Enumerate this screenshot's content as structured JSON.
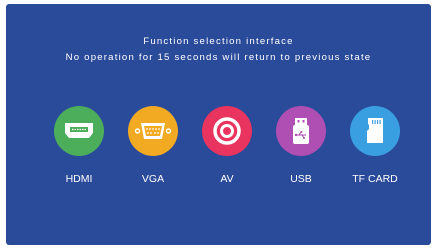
{
  "header": {
    "title": "Function selection interface",
    "subtitle": "No operation for 15 seconds will return to previous state"
  },
  "sources": [
    {
      "label": "HDMI",
      "icon": "hdmi-port-icon",
      "color": "#4cae5a"
    },
    {
      "label": "VGA",
      "icon": "vga-port-icon",
      "color": "#f2aa22"
    },
    {
      "label": "AV",
      "icon": "av-ring-icon",
      "color": "#e8345f"
    },
    {
      "label": "USB",
      "icon": "usb-drive-icon",
      "color": "#b04fb3"
    },
    {
      "label": "TF CARD",
      "icon": "tf-card-icon",
      "color": "#3a9fe0"
    }
  ],
  "colors": {
    "background": "#2a4a9a",
    "text": "#ffffff"
  }
}
